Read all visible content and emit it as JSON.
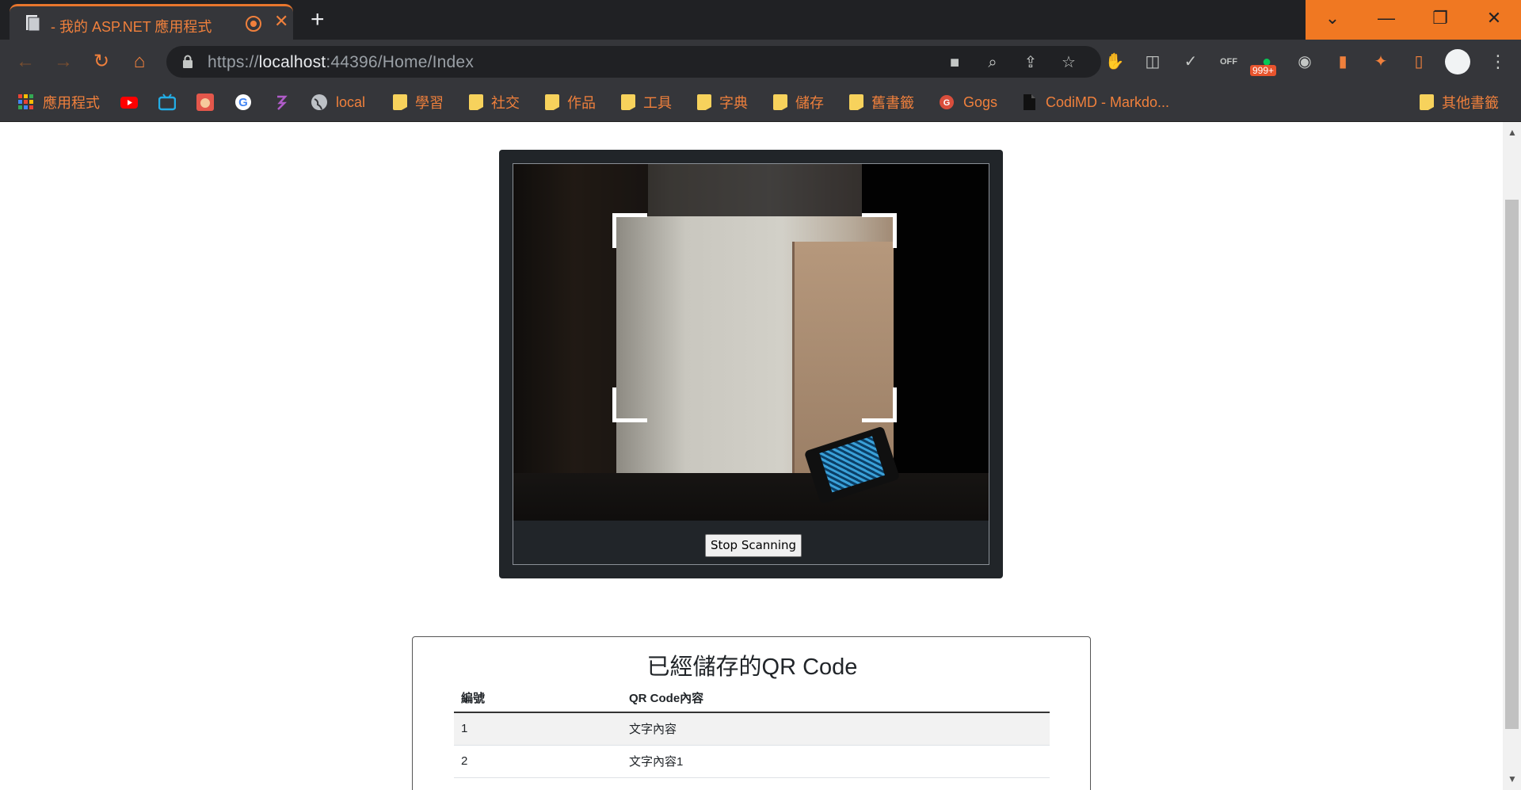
{
  "browser": {
    "tab_title": "- 我的 ASP.NET 應用程式",
    "url_scheme": "https://",
    "url_host": "localhost",
    "url_path": ":44396/Home/Index",
    "extension_badge": "999+",
    "accent_color": "#f0803c",
    "bookmarks": [
      {
        "label": "應用程式",
        "icon": "apps-grid-icon"
      },
      {
        "label": "",
        "icon": "youtube-icon"
      },
      {
        "label": "",
        "icon": "bilibili-icon"
      },
      {
        "label": "",
        "icon": "anime-avatar-icon"
      },
      {
        "label": "",
        "icon": "google-icon"
      },
      {
        "label": "",
        "icon": "feather-icon"
      },
      {
        "label": "local",
        "icon": "globe-icon"
      },
      {
        "label": "學習",
        "icon": "folder-icon"
      },
      {
        "label": "社交",
        "icon": "folder-icon"
      },
      {
        "label": "作品",
        "icon": "folder-icon"
      },
      {
        "label": "工具",
        "icon": "folder-icon"
      },
      {
        "label": "字典",
        "icon": "folder-icon"
      },
      {
        "label": "儲存",
        "icon": "folder-icon"
      },
      {
        "label": "舊書籤",
        "icon": "folder-icon"
      },
      {
        "label": "Gogs",
        "icon": "gogs-icon"
      },
      {
        "label": "CodiMD - Markdo...",
        "icon": "document-icon"
      },
      {
        "label": "其他書籤",
        "icon": "folder-icon"
      }
    ]
  },
  "scanner": {
    "stop_button_label": "Stop Scanning"
  },
  "saved": {
    "title": "已經儲存的QR  Code",
    "columns": [
      "編號",
      "QR  Code內容"
    ],
    "rows": [
      [
        "1",
        "文字內容"
      ],
      [
        "2",
        "文字內容1"
      ]
    ]
  }
}
